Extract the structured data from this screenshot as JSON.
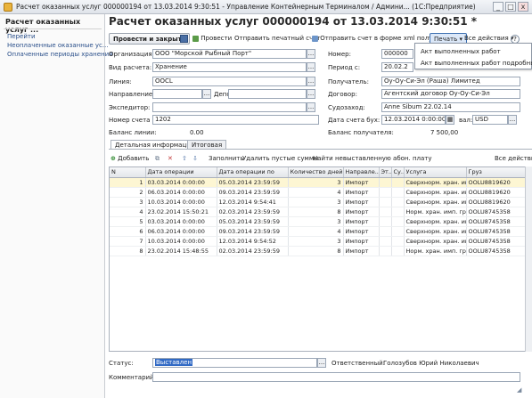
{
  "window": {
    "title": "Расчет оказанных услуг 000000194 от 13.03.2014 9:30:51 - Управление Контейнерным Терминалом / Админи... (1С:Предприятие)",
    "btn_min": "_",
    "btn_max": "□",
    "btn_close": "x"
  },
  "sidebar": {
    "title": "Расчет оказанных услуг ...",
    "items": [
      {
        "label": "Перейти"
      },
      {
        "label": "Неоплаченные оказанные ус..."
      },
      {
        "label": "Оплаченные периоды хранения"
      }
    ]
  },
  "doc": {
    "title": "Расчет оказанных услуг 000000194 от 13.03.2014 9:30:51 *"
  },
  "toolbar": {
    "post_close": "Провести и закрыть",
    "post": "Провести",
    "send_print": "Отправить печатный счет",
    "send_xml": "Отправить счет в форме xml получателю",
    "print": "Печать",
    "all_actions": "Все действия",
    "help": "?"
  },
  "print_menu": {
    "items": [
      "Акт выполненных работ",
      "Акт выполненных работ подробный"
    ]
  },
  "form": {
    "org_label": "Организация:",
    "org_value": "ООО \"Морской Рыбный Порт\"",
    "number_label": "Номер:",
    "number_value": "000000",
    "calc_type_label": "Вид расчета:",
    "calc_type_value": "Хранение",
    "period_label": "Период с:",
    "period_value": "20.02.2",
    "line_label": "Линия:",
    "line_value": "OOCL",
    "receiver_label": "Получатель:",
    "receiver_value": "Оу-Оу-Си-Эл (Раша) Лимитед",
    "direction_label": "Направление:",
    "depot_label": "Депо:",
    "contract_label": "Договор:",
    "contract_value": "Агентский договор Оу-Оу-Си-Эл",
    "forwarder_label": "Экспедитор:",
    "ship_label": "Судозаход:",
    "ship_value": "Anne Sibum 22.02.14",
    "invoice_no_label": "Номер счета бух:",
    "invoice_no_value": "1202",
    "invoice_date_label": "Дата счета бух:",
    "invoice_date_value": "12.03.2014 0:00:00",
    "currency_label": "вал:",
    "currency_value": "USD",
    "line_balance_label": "Баланс линии:",
    "line_balance_value": "0.00",
    "receiver_balance_label": "Баланс получателя:",
    "receiver_balance_value": "7 500,00"
  },
  "tabs": [
    {
      "label": "Детальная информация"
    },
    {
      "label": "Итоговая"
    }
  ],
  "grid_toolbar": {
    "add": "Добавить",
    "fill": "Заполнить",
    "delete_empty": "Удалить пустые суммы",
    "find_unbilled": "Найти невыставленную абон. плату",
    "all_actions": "Все действия"
  },
  "grid": {
    "columns": [
      "N",
      "Дата операции",
      "Дата операции по",
      "Количество дней",
      "Направле...",
      "Эт...",
      "Су...",
      "Услуга",
      "Груз"
    ],
    "rows": [
      [
        "1",
        "03.03.2014 0:00:00",
        "05.03.2014 23:59:59",
        "3",
        "Импорт",
        "",
        "",
        "Сверхнорм. хран. имп...",
        "OOLU8819620"
      ],
      [
        "2",
        "06.03.2014 0:00:00",
        "09.03.2014 23:59:59",
        "4",
        "Импорт",
        "",
        "",
        "Сверхнорм. хран. имп...",
        "OOLU8819620"
      ],
      [
        "3",
        "10.03.2014 0:00:00",
        "12.03.2014 9:54:41",
        "3",
        "Импорт",
        "",
        "",
        "Сверхнорм. хран. имп...",
        "OOLU8819620"
      ],
      [
        "4",
        "23.02.2014 15:50:21",
        "02.03.2014 23:59:59",
        "8",
        "Импорт",
        "",
        "",
        "Норм. хран. имп. гру...",
        "OOLU8745358"
      ],
      [
        "5",
        "03.03.2014 0:00:00",
        "05.03.2014 23:59:59",
        "3",
        "Импорт",
        "",
        "",
        "Сверхнорм. хран. имп...",
        "OOLU8745358"
      ],
      [
        "6",
        "06.03.2014 0:00:00",
        "09.03.2014 23:59:59",
        "4",
        "Импорт",
        "",
        "",
        "Сверхнорм. хран. имп...",
        "OOLU8745358"
      ],
      [
        "7",
        "10.03.2014 0:00:00",
        "12.03.2014 9:54:52",
        "3",
        "Импорт",
        "",
        "",
        "Сверхнорм. хран. имп...",
        "OOLU8745358"
      ],
      [
        "8",
        "23.02.2014 15:48:55",
        "02.03.2014 23:59:59",
        "8",
        "Импорт",
        "",
        "",
        "Норм. хран. имп. гру...",
        "OOLU8745358"
      ]
    ]
  },
  "footer": {
    "status_label": "Статус:",
    "status_value": "Выставлен",
    "responsible_label": "Ответственный:",
    "responsible_value": "Голозубов Юрий Николаевич",
    "comment_label": "Комментарий:"
  },
  "colors": {
    "accent": "#2a4f8a",
    "selected_row": "#fdf6d3",
    "status_highlight": "#316ac5"
  }
}
